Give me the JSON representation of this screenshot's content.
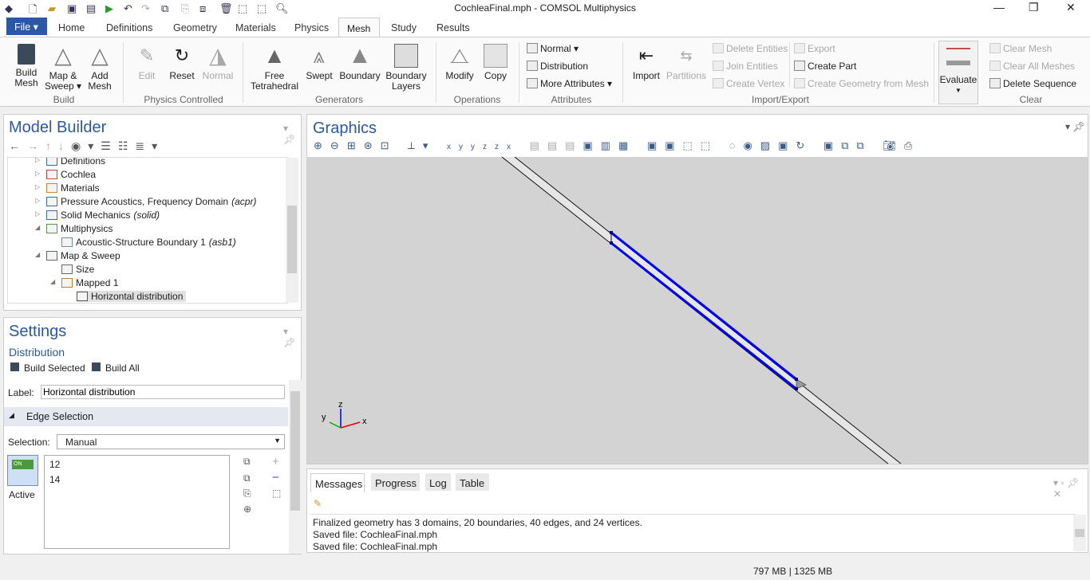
{
  "window": {
    "title": "CochleaFinal.mph - COMSOL Multiphysics"
  },
  "menu": {
    "file": "File ▾",
    "tabs": [
      "Home",
      "Definitions",
      "Geometry",
      "Materials",
      "Physics",
      "Mesh",
      "Study",
      "Results"
    ],
    "active": "Mesh"
  },
  "ribbon": {
    "build": {
      "build_mesh": "Build\nMesh",
      "map_sweep": "Map &\nSweep ▾",
      "add_mesh": "Add\nMesh",
      "group": "Build"
    },
    "physics_controlled": {
      "edit": "Edit",
      "reset": "Reset",
      "normal": "Normal",
      "group": "Physics Controlled"
    },
    "generators": {
      "free_tet": "Free\nTetrahedral",
      "swept": "Swept",
      "boundary": "Boundary",
      "boundary_layers": "Boundary\nLayers",
      "group": "Generators"
    },
    "operations": {
      "modify": "Modify",
      "copy": "Copy",
      "group": "Operations"
    },
    "attributes": {
      "normal": "Normal ▾",
      "distribution": "Distribution",
      "more": "More Attributes ▾",
      "group": "Attributes"
    },
    "import_export": {
      "import": "Import",
      "partitions": "Partitions",
      "delete_entities": "Delete Entities",
      "join_entities": "Join Entities",
      "create_vertex": "Create Vertex",
      "export": "Export",
      "create_part": "Create Part",
      "create_geometry": "Create Geometry from Mesh",
      "group": "Import/Export"
    },
    "evaluate": "Evaluate",
    "clear": {
      "clear_mesh": "Clear Mesh",
      "clear_all": "Clear All Meshes",
      "delete_sequence": "Delete Sequence",
      "group": "Clear"
    }
  },
  "model_builder": {
    "title": "Model Builder",
    "tree": [
      {
        "label": "Definitions",
        "level": 0,
        "expander": "▷"
      },
      {
        "label": "Cochlea",
        "level": 0,
        "expander": "▷"
      },
      {
        "label": "Materials",
        "level": 0,
        "expander": "▷"
      },
      {
        "label": "Pressure Acoustics, Frequency Domain",
        "tag": "(acpr)",
        "level": 0,
        "expander": "▷"
      },
      {
        "label": "Solid Mechanics",
        "tag": "(solid)",
        "level": 0,
        "expander": "▷"
      },
      {
        "label": "Multiphysics",
        "level": 0,
        "expander": "◢"
      },
      {
        "label": "Acoustic-Structure Boundary 1",
        "tag": "(asb1)",
        "level": 1,
        "expander": ""
      },
      {
        "label": "Map & Sweep",
        "level": 0,
        "expander": "◢"
      },
      {
        "label": "Size",
        "level": 1,
        "expander": ""
      },
      {
        "label": "Mapped 1",
        "level": 1,
        "expander": "◢"
      },
      {
        "label": "Horizontal distribution",
        "level": 2,
        "expander": "",
        "selected": true
      }
    ]
  },
  "settings": {
    "title": "Settings",
    "subtitle": "Distribution",
    "build_selected": "Build Selected",
    "build_all": "Build All",
    "label_caption": "Label:",
    "label_value": "Horizontal distribution",
    "section": "Edge Selection",
    "selection_caption": "Selection:",
    "selection_value": "Manual",
    "items": [
      "12",
      "14"
    ],
    "active_toggle": "ON",
    "active_label": "Active"
  },
  "graphics": {
    "title": "Graphics",
    "axes": {
      "x": "x",
      "y": "y",
      "z": "z"
    },
    "selection_color": "#0000ff"
  },
  "messages": {
    "tabs": [
      "Messages",
      "Progress",
      "Log",
      "Table"
    ],
    "active": "Messages",
    "lines": [
      "Finalized geometry has 3 domains, 20 boundaries, 40 edges, and 24 vertices.",
      "Saved file: CochleaFinal.mph",
      "Saved file: CochleaFinal.mph"
    ]
  },
  "status": {
    "memory": "797 MB | 1325 MB"
  }
}
